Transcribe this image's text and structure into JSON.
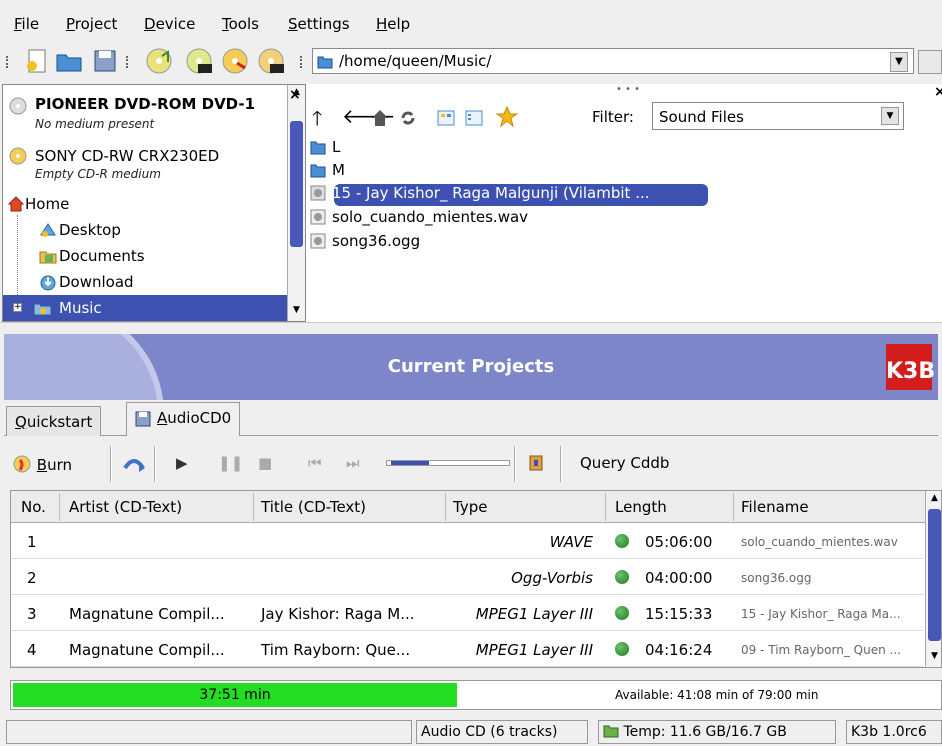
{
  "menu": [
    {
      "underline": "F",
      "rest": "ile"
    },
    {
      "underline": "P",
      "rest": "roject"
    },
    {
      "underline": "D",
      "rest": "evice"
    },
    {
      "underline": "T",
      "rest": "ools"
    },
    {
      "underline": "S",
      "rest": "ettings"
    },
    {
      "underline": "H",
      "rest": "elp"
    }
  ],
  "location": {
    "path": "/home/queen/Music/"
  },
  "tree": {
    "devices": [
      {
        "name": "PIONEER DVD-ROM DVD-1",
        "status": "No medium present"
      },
      {
        "name": "SONY CD-RW  CRX230ED",
        "status": "Empty CD-R medium"
      }
    ],
    "home_label": "Home",
    "folders": [
      "Desktop",
      "Documents",
      "Download",
      "Music"
    ]
  },
  "file_browser": {
    "filter_label": "Filter:",
    "filter_value": "Sound Files",
    "files": [
      {
        "name": "L",
        "kind": "folder"
      },
      {
        "name": "M",
        "kind": "folder"
      },
      {
        "name": "15 - Jay Kishor_ Raga Malgunji (Vilambit ...",
        "kind": "audio",
        "selected": true
      },
      {
        "name": "solo_cuando_mientes.wav",
        "kind": "audio"
      },
      {
        "name": "song36.ogg",
        "kind": "audio"
      }
    ]
  },
  "projects": {
    "header_title": "Current Projects",
    "logo_text": "K3B",
    "tabs": [
      {
        "underline": "Q",
        "rest": "uickstart"
      },
      {
        "underline": "A",
        "rest": "udioCD0"
      }
    ],
    "toolbar": {
      "burn_underline": "B",
      "burn_rest": "urn",
      "query_label": "Query Cddb"
    },
    "columns": [
      "No.",
      "Artist (CD-Text)",
      "Title (CD-Text)",
      "Type",
      "Length",
      "Filename"
    ],
    "tracks": [
      {
        "no": "1",
        "artist": "",
        "title": "",
        "type": "WAVE",
        "length": "05:06:00",
        "filename": "solo_cuando_mientes.wav"
      },
      {
        "no": "2",
        "artist": "",
        "title": "",
        "type": "Ogg-Vorbis",
        "length": "04:00:00",
        "filename": "song36.ogg"
      },
      {
        "no": "3",
        "artist": "Magnatune Compil...",
        "title": "Jay Kishor: Raga M...",
        "type": "MPEG1 Layer III",
        "length": "15:15:33",
        "filename": "15 - Jay Kishor_ Raga Ma..."
      },
      {
        "no": "4",
        "artist": "Magnatune Compil...",
        "title": "Tim Rayborn: Que...",
        "type": "MPEG1 Layer III",
        "length": "04:16:24",
        "filename": "09 - Tim Rayborn_ Quen ..."
      }
    ],
    "used_label": "37:51 min",
    "used_fraction": 0.4792,
    "available_label": "Available: 41:08 min of 79:00 min"
  },
  "statusbar": {
    "project_info": "Audio CD (6 tracks)",
    "temp_info": "Temp: 11.6 GB/16.7 GB",
    "version": "K3b 1.0rc6"
  },
  "colors": {
    "selection": "#3d52b0",
    "progress": "#22dd22",
    "header": "#7d86c8"
  }
}
